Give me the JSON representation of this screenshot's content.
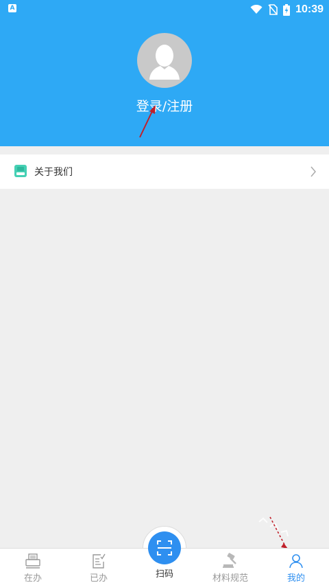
{
  "status_bar": {
    "app_badge": "A",
    "time": "10:39"
  },
  "profile": {
    "login_label": "登录/注册"
  },
  "menu": {
    "about_label": "关于我们"
  },
  "bottom_nav": {
    "items": [
      {
        "label": "在办",
        "icon": "printer-icon"
      },
      {
        "label": "已办",
        "icon": "checklist-icon"
      },
      {
        "label": "扫码",
        "icon": "scan-icon"
      },
      {
        "label": "材料规范",
        "icon": "gavel-icon"
      },
      {
        "label": "我的",
        "icon": "user-icon"
      }
    ],
    "active_index": 4
  },
  "colors": {
    "header_bg": "#2ea9f5",
    "accent": "#2e8ff0",
    "page_bg": "#efefef"
  }
}
